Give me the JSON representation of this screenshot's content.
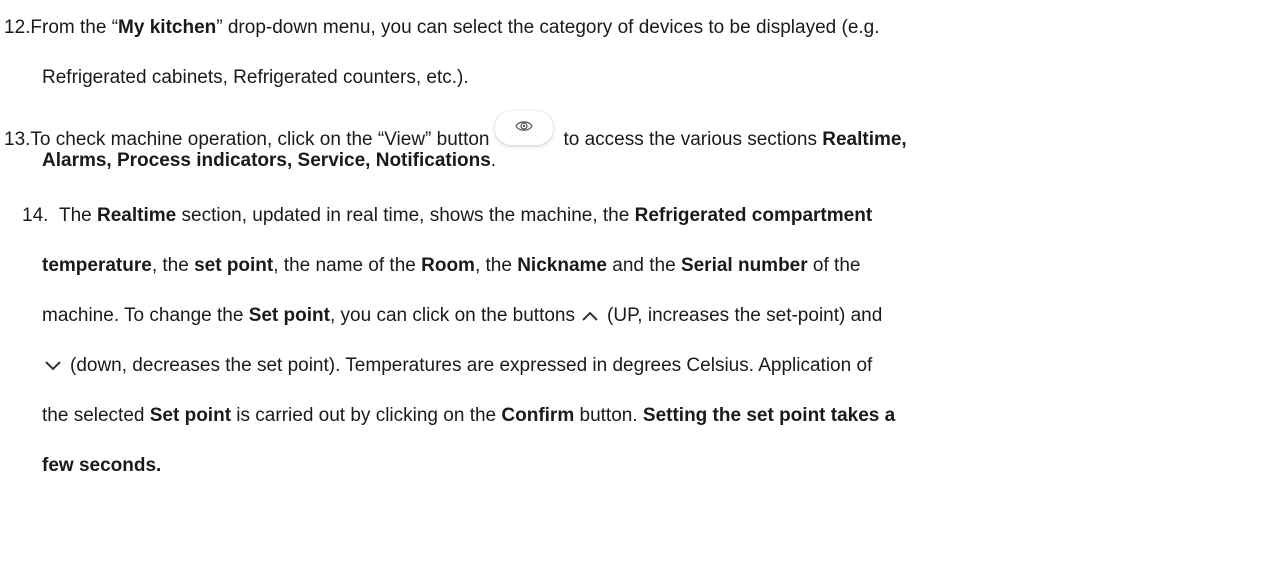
{
  "item12": {
    "number": "12.",
    "t1": "From the “",
    "b1": "My kitchen",
    "t2": "” drop-down menu, you can select the category of devices to be displayed (e.g.",
    "line2": "Refrigerated cabinets, Refrigerated counters, etc.)."
  },
  "item13": {
    "number": "13.",
    "t1": "To check machine operation, click on the “View” button",
    "t2": "to access the various sections ",
    "b1": "Realtime,",
    "b2": "Alarms, Process indicators, Service, Notifications",
    "t3": "."
  },
  "item14": {
    "number": "14.",
    "l1_t1": "The ",
    "l1_b1": "Realtime",
    "l1_t2": " section, updated in real time, shows the machine, the ",
    "l1_b2": "Refrigerated compartment",
    "l2_b1": "temperature",
    "l2_t1": ", the ",
    "l2_b2": "set point",
    "l2_t2": ", the name of the ",
    "l2_b3": "Room",
    "l2_t3": ", the ",
    "l2_b4": "Nickname",
    "l2_t4": " and the ",
    "l2_b5": "Serial number",
    "l2_t5": " of the",
    "l3_t1": "machine. To change the ",
    "l3_b1": "Set point",
    "l3_t2": ", you can click on the buttons",
    "l3_t3": "(UP, increases the set-point) and",
    "l4_t1": "(down, decreases the set point). Temperatures are expressed in degrees Celsius. Application of",
    "l5_t1": "the selected ",
    "l5_b1": "Set point",
    "l5_t2": " is carried out by clicking on the ",
    "l5_b2": "Confirm",
    "l5_t3": " button. ",
    "l5_b3": "Setting the set point takes a",
    "l6_b1": "few seconds."
  },
  "icons": {
    "view": "eye-icon",
    "up": "chevron-up-icon",
    "down": "chevron-down-icon"
  }
}
